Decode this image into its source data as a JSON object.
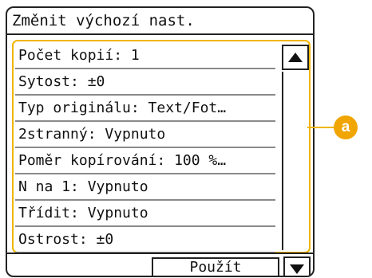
{
  "title": "Změnit výchozí nast.",
  "settings": {
    "items": [
      {
        "label": "Počet kopií:  1"
      },
      {
        "label": "Sytost: ±0"
      },
      {
        "label": "Typ originálu: Text/Fot…"
      },
      {
        "label": "2stranný: Vypnuto"
      },
      {
        "label": "Poměr kopírování: 100 %…"
      },
      {
        "label": "N na 1: Vypnuto"
      },
      {
        "label": "Třídit: Vypnuto"
      },
      {
        "label": "Ostrost: ±0"
      }
    ]
  },
  "footer": {
    "apply_label": "Použít"
  },
  "callout": {
    "label": "a"
  },
  "icons": {
    "scroll_up": "triangle-up-icon",
    "scroll_down": "triangle-down-icon"
  },
  "colors": {
    "highlight": "#f0b400",
    "badge": "#f0a500"
  }
}
